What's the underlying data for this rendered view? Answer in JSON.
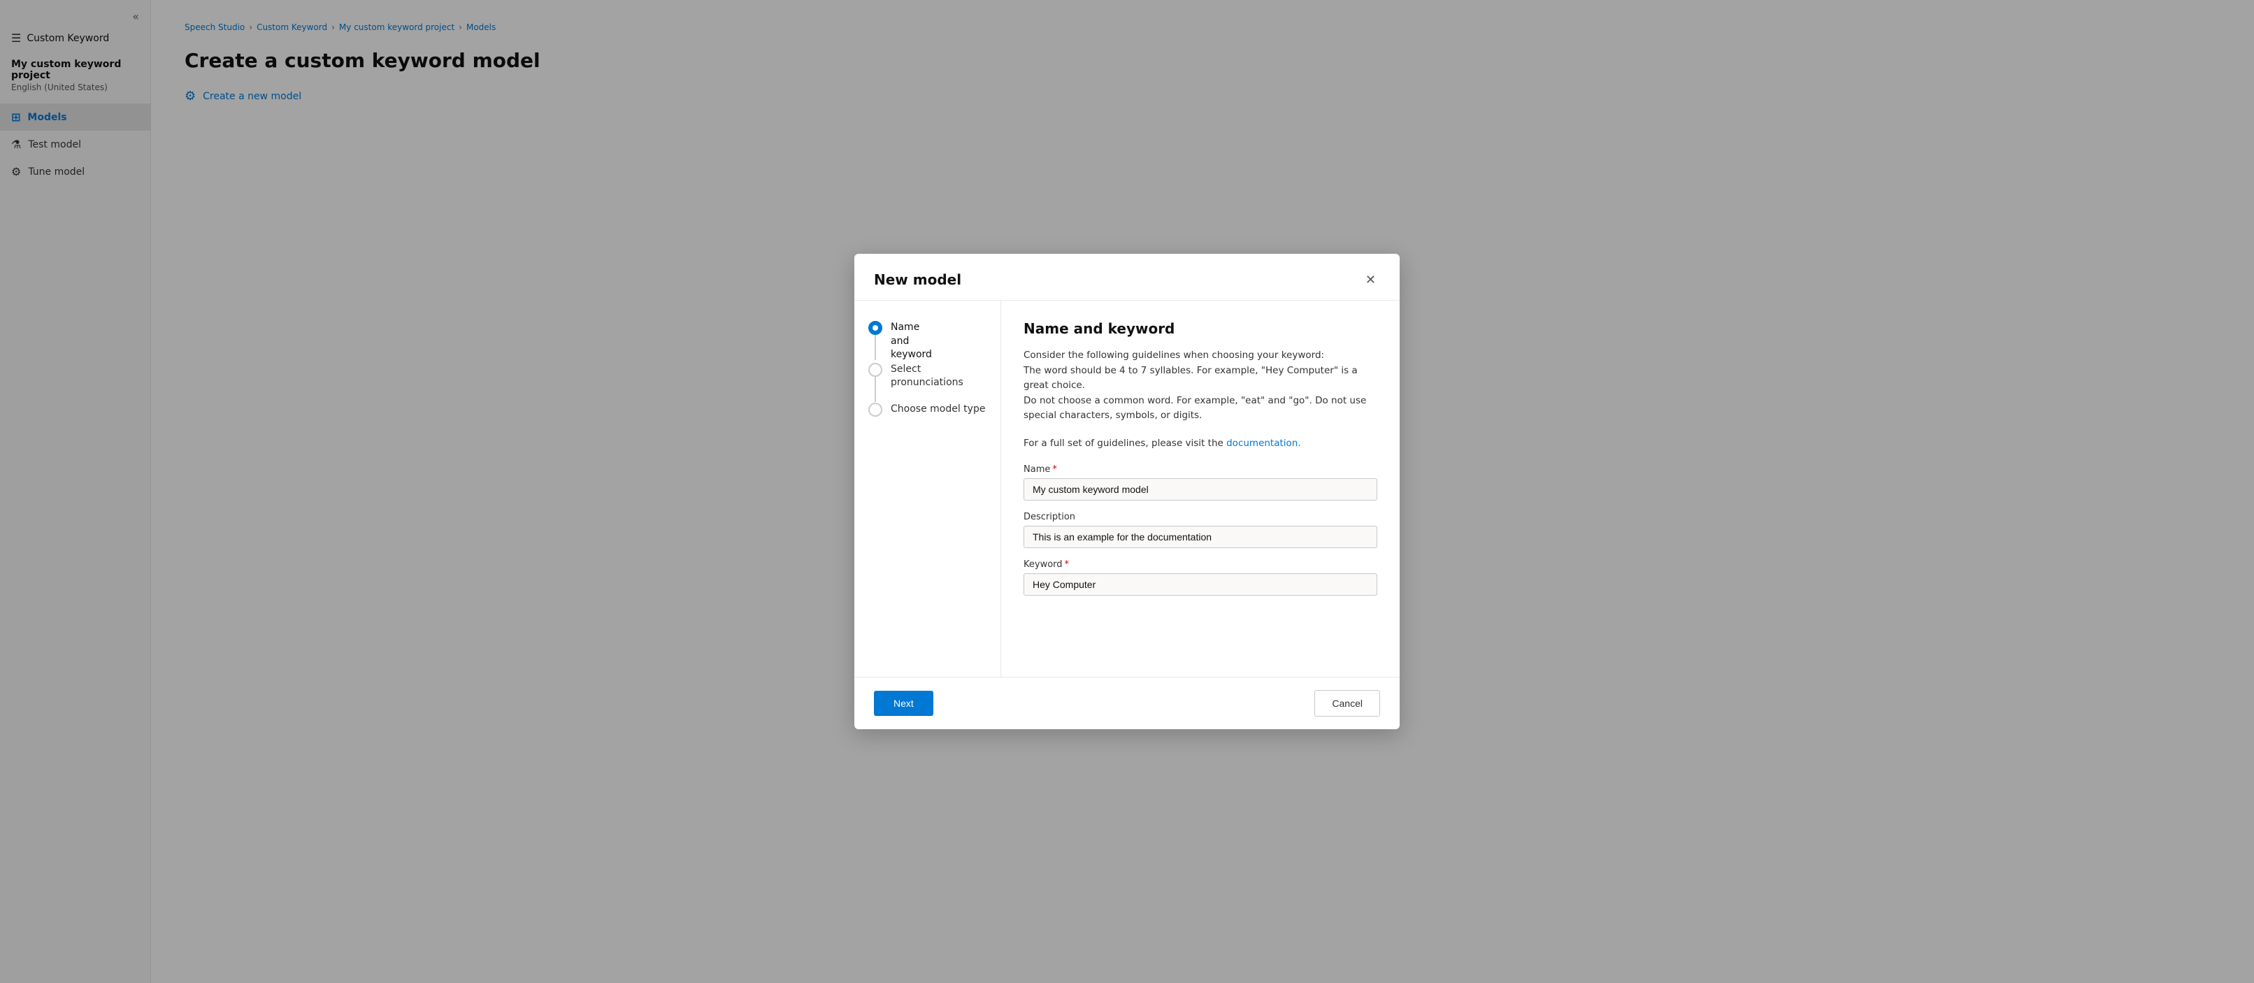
{
  "sidebar": {
    "collapse_icon": "«",
    "menu_icon": "☰",
    "title": "Custom Keyword",
    "project_name": "My custom keyword project",
    "project_lang": "English (United States)",
    "nav_items": [
      {
        "id": "models",
        "label": "Models",
        "icon": "⊞",
        "active": true
      },
      {
        "id": "test-model",
        "label": "Test model",
        "icon": "⚗"
      },
      {
        "id": "tune-model",
        "label": "Tune model",
        "icon": "⚙"
      }
    ]
  },
  "breadcrumb": {
    "items": [
      "Speech Studio",
      "Custom Keyword",
      "My custom keyword project",
      "Models"
    ],
    "separators": [
      "›",
      "›",
      "›"
    ]
  },
  "page": {
    "title": "Create a custom keyword model"
  },
  "background": {
    "create_link": "Create a new model"
  },
  "dialog": {
    "title": "New model",
    "close_icon": "✕",
    "steps": [
      {
        "id": "name-and-keyword",
        "label": "Name and keyword",
        "active": true
      },
      {
        "id": "select-pronunciations",
        "label": "Select pronunciations",
        "active": false
      },
      {
        "id": "choose-model-type",
        "label": "Choose model type",
        "active": false
      }
    ],
    "content": {
      "title": "Name and keyword",
      "guidelines": {
        "line1": "Consider the following guidelines when choosing your keyword:",
        "line2": "The word should be 4 to 7 syllables. For example, \"Hey Computer\" is a great choice.",
        "line3": "Do not choose a common word. For example, \"eat\" and \"go\". Do not use special characters, symbols, or digits.",
        "line4": "For a full set of guidelines, please visit the",
        "doc_link_text": "documentation.",
        "doc_link_href": "#"
      },
      "fields": {
        "name_label": "Name",
        "name_required": true,
        "name_value": "My custom keyword model",
        "description_label": "Description",
        "description_required": false,
        "description_value": "This is an example for the documentation",
        "keyword_label": "Keyword",
        "keyword_required": true,
        "keyword_value": "Hey Computer"
      }
    },
    "footer": {
      "next_label": "Next",
      "cancel_label": "Cancel"
    }
  }
}
